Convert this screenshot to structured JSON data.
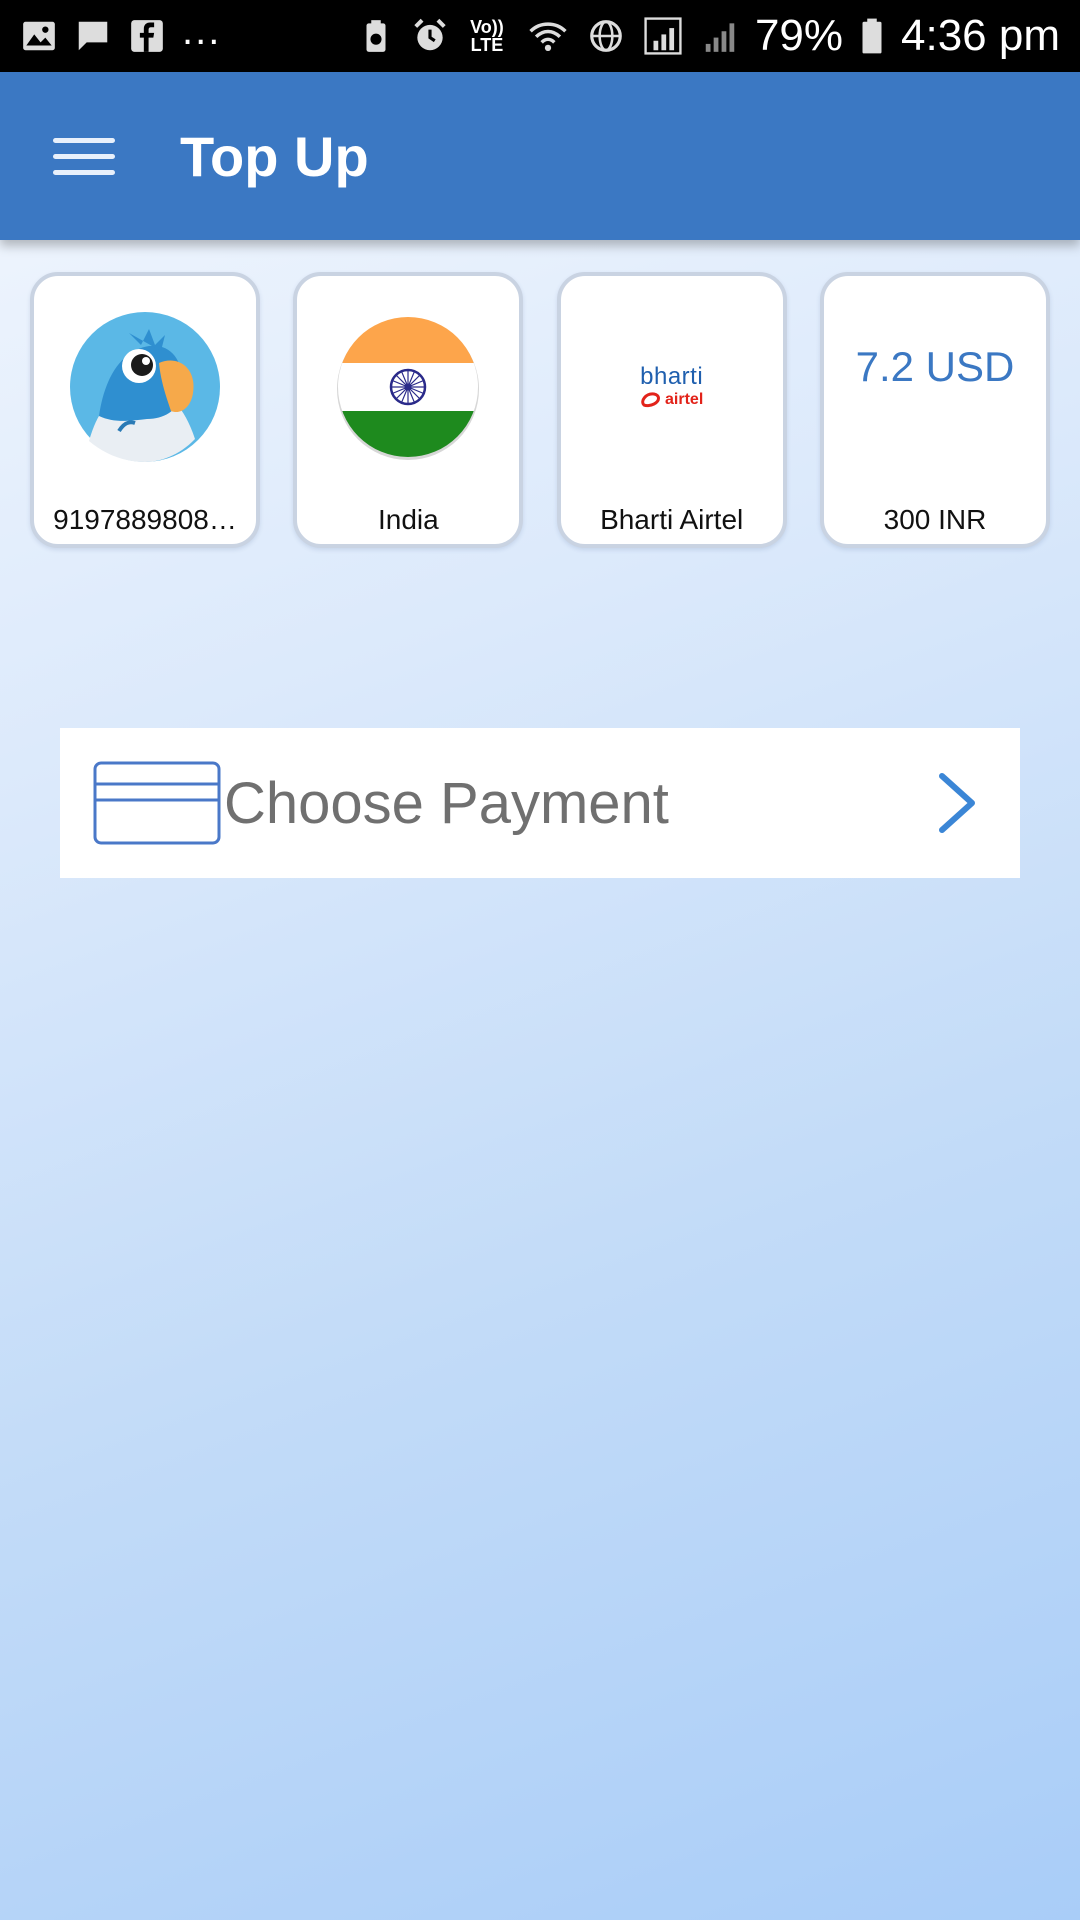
{
  "status_bar": {
    "dots": "...",
    "network_label_top": "Vo))",
    "network_label_bottom": "LTE",
    "battery_percent": "79%",
    "time": "4:36 pm",
    "icons": [
      "image-icon",
      "message-icon",
      "facebook-icon",
      "battery-saver-icon",
      "alarm-icon",
      "volte-icon",
      "wifi-icon",
      "globe-icon",
      "signal-roaming-icon",
      "signal-icon",
      "battery-icon"
    ]
  },
  "app_bar": {
    "title": "Top Up",
    "menu_icon": "hamburger-menu-icon",
    "color": "#3b78c3"
  },
  "cards": {
    "contact": {
      "label": "9197889808…",
      "icon": "parrot-avatar-icon"
    },
    "country": {
      "label": "India",
      "icon": "india-flag-icon"
    },
    "operator": {
      "label": "Bharti Airtel",
      "logo_top": "bharti",
      "logo_bottom": "airtel"
    },
    "amount": {
      "price": "7.2 USD",
      "label": "300 INR"
    }
  },
  "payment": {
    "label": "Choose Payment",
    "icon": "credit-card-icon",
    "chevron": "chevron-right-icon"
  },
  "colors": {
    "accent": "#3b78c3",
    "text_gray": "#707070"
  }
}
